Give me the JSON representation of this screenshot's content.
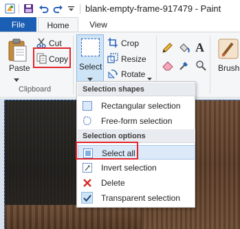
{
  "window": {
    "title": "blank-empty-frame-917479 - Paint"
  },
  "quick_access": [
    "save-icon",
    "undo-icon",
    "redo-icon",
    "customize-dropdown-icon"
  ],
  "tabs": [
    {
      "label": "File"
    },
    {
      "label": "Home"
    },
    {
      "label": "View"
    }
  ],
  "clipboard": {
    "group_label": "Clipboard",
    "paste_label": "Paste",
    "cut_label": "Cut",
    "copy_label": "Copy"
  },
  "image_group": {
    "select_label": "Select",
    "crop_label": "Crop",
    "resize_label": "Resize",
    "rotate_label": "Rotate"
  },
  "tools": [
    "pencil-icon",
    "fill-bucket-icon",
    "text-icon",
    "eraser-icon",
    "color-picker-icon",
    "magnifier-icon"
  ],
  "brushes_label": "Brushes",
  "select_menu": {
    "shapes_header": "Selection shapes",
    "rectangular": "Rectangular selection",
    "freeform": "Free-form selection",
    "options_header": "Selection options",
    "select_all": "Select all",
    "invert": "Invert selection",
    "delete": "Delete",
    "transparent": "Transparent selection"
  },
  "colors": {
    "accent": "#1b5fb5",
    "highlight": "#e1232b",
    "menu_hover": "#dbe9f8"
  }
}
